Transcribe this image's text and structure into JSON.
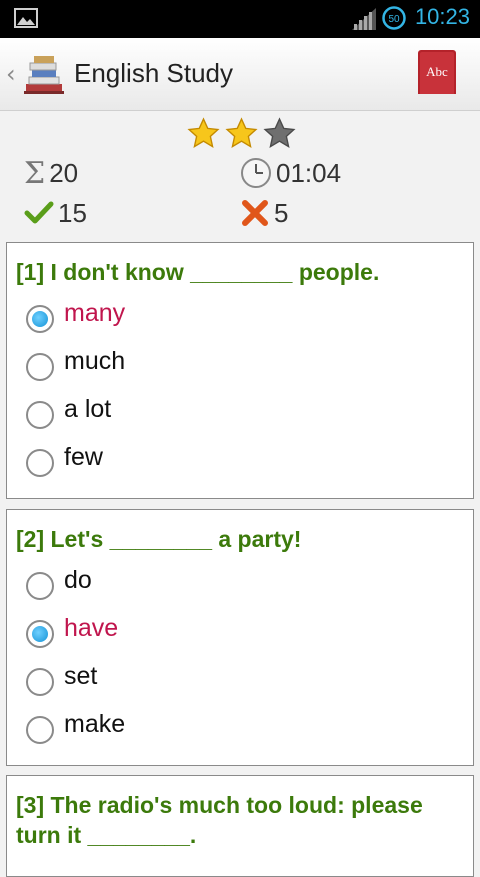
{
  "status_bar": {
    "time": "10:23",
    "battery_level": "50"
  },
  "action_bar": {
    "title": "English Study",
    "back_glyph": "‹",
    "logo_icon": "books-icon",
    "dict_label": "Abc"
  },
  "stats": {
    "stars_filled": 2,
    "stars_total": 3,
    "total": "20",
    "time": "01:04",
    "correct": "15",
    "wrong": "5"
  },
  "questions": [
    {
      "text": "[1] I don't know ________ people.",
      "options": [
        "many",
        "much",
        "a lot",
        "few"
      ],
      "selected": 0
    },
    {
      "text": "[2] Let's ________ a party!",
      "options": [
        "do",
        "have",
        "set",
        "make"
      ],
      "selected": 1
    },
    {
      "text": "[3] The radio's much too loud: please turn it ________.",
      "options": []
    }
  ],
  "colors": {
    "question_text": "#3c7a0b",
    "selected_option": "#c0154d",
    "status_accent": "#33b5e5"
  }
}
